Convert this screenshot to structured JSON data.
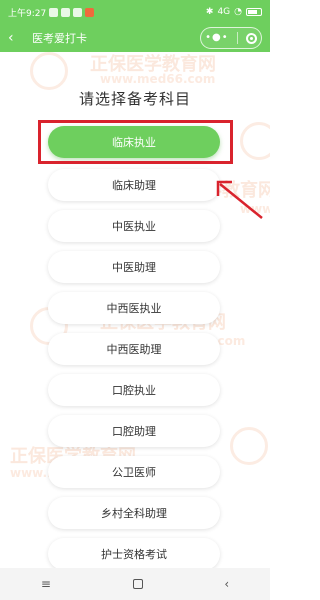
{
  "status_bar": {
    "time": "上午9:27",
    "signal_text": "4G"
  },
  "nav": {
    "title": "医考爱打卡"
  },
  "watermark": {
    "brand": "正保医学教育网",
    "url": "www.med66.com"
  },
  "page_title": "请选择备考科目",
  "subjects": [
    {
      "label": "临床执业"
    },
    {
      "label": "临床助理"
    },
    {
      "label": "中医执业"
    },
    {
      "label": "中医助理"
    },
    {
      "label": "中西医执业"
    },
    {
      "label": "中西医助理"
    },
    {
      "label": "口腔执业"
    },
    {
      "label": "口腔助理"
    },
    {
      "label": "公卫医师"
    },
    {
      "label": "乡村全科助理"
    },
    {
      "label": "护士资格考试"
    }
  ],
  "colors": {
    "brand_green": "#6ecf5e",
    "highlight_red": "#d9232d"
  },
  "icons": {
    "back": "chevron-left-icon",
    "more": "more-dots-icon",
    "close": "target-circle-icon"
  }
}
